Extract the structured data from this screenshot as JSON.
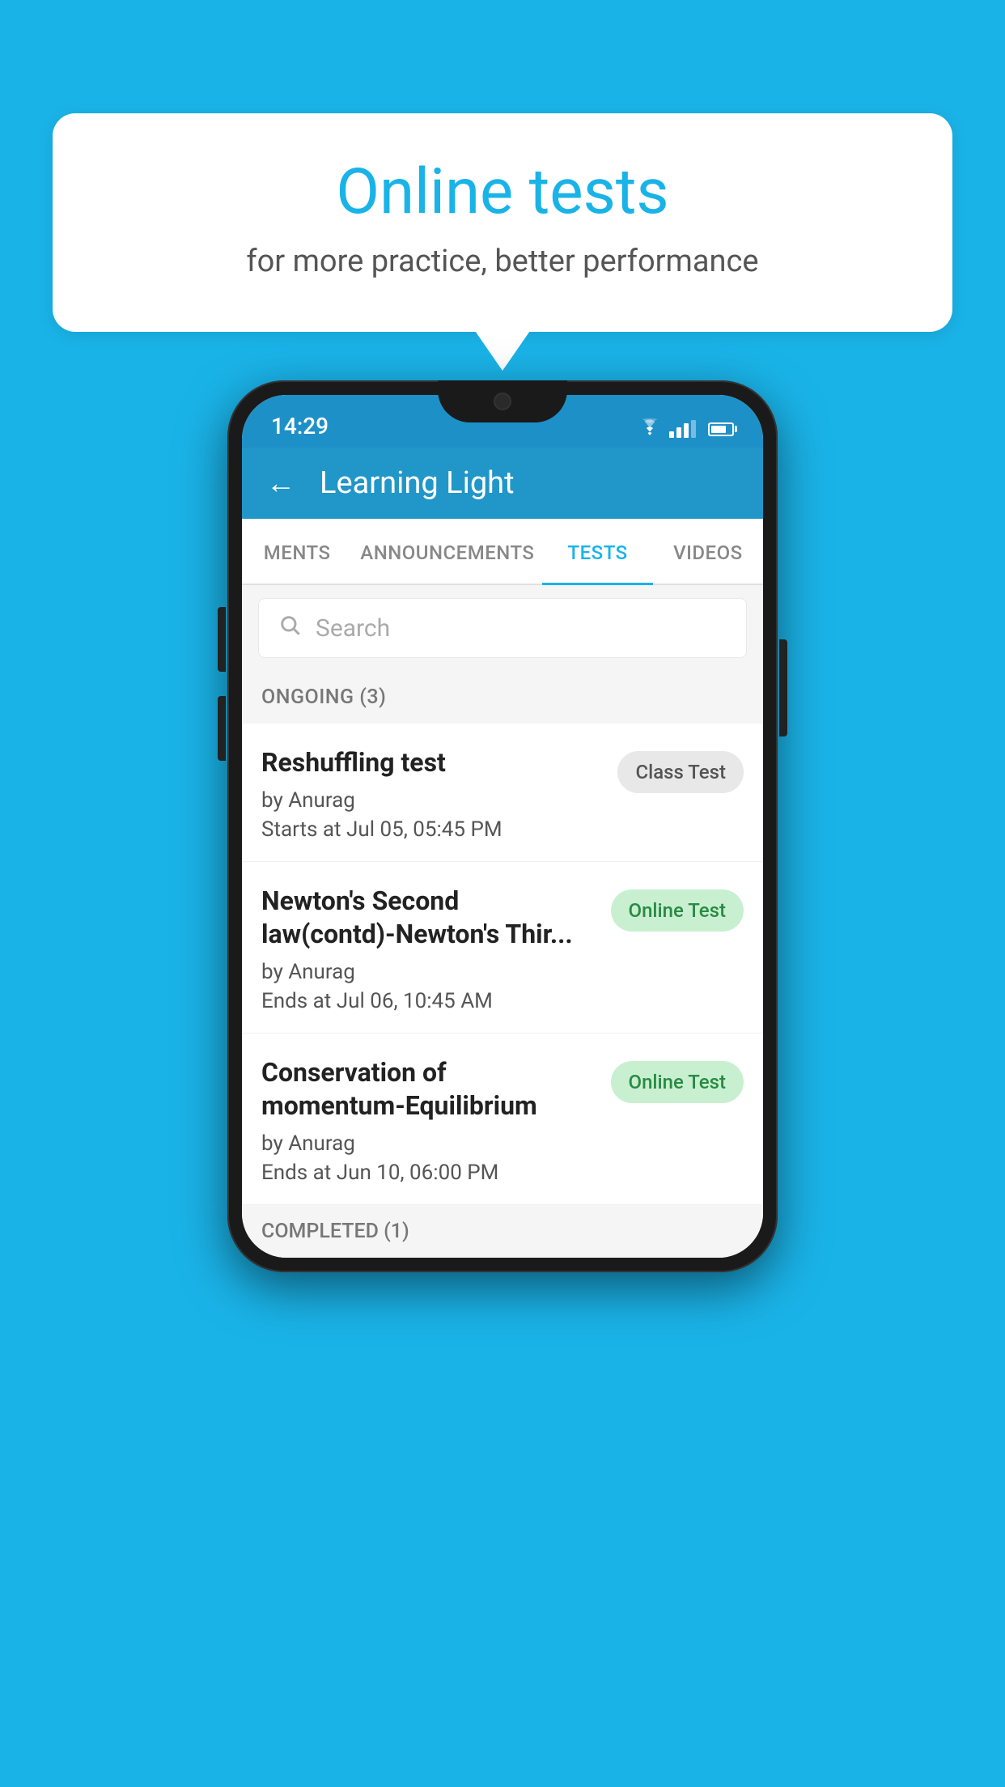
{
  "background_color": "#1ab3e8",
  "speech_bubble": {
    "title": "Online tests",
    "subtitle": "for more practice, better performance"
  },
  "phone": {
    "status_bar": {
      "time": "14:29"
    },
    "app_header": {
      "title": "Learning Light",
      "back_label": "←"
    },
    "tabs": [
      {
        "label": "MENTS",
        "active": false
      },
      {
        "label": "ANNOUNCEMENTS",
        "active": false
      },
      {
        "label": "TESTS",
        "active": true
      },
      {
        "label": "VIDEOS",
        "active": false
      }
    ],
    "search": {
      "placeholder": "Search"
    },
    "ongoing_section": {
      "title": "ONGOING (3)"
    },
    "test_items": [
      {
        "name": "Reshuffling test",
        "author": "by Anurag",
        "date_label": "Starts at",
        "date": "Jul 05, 05:45 PM",
        "badge": "Class Test",
        "badge_type": "class"
      },
      {
        "name": "Newton's Second law(contd)-Newton's Thir...",
        "author": "by Anurag",
        "date_label": "Ends at",
        "date": "Jul 06, 10:45 AM",
        "badge": "Online Test",
        "badge_type": "online"
      },
      {
        "name": "Conservation of momentum-Equilibrium",
        "author": "by Anurag",
        "date_label": "Ends at",
        "date": "Jun 10, 06:00 PM",
        "badge": "Online Test",
        "badge_type": "online"
      }
    ],
    "completed_section": {
      "title": "COMPLETED (1)"
    }
  }
}
